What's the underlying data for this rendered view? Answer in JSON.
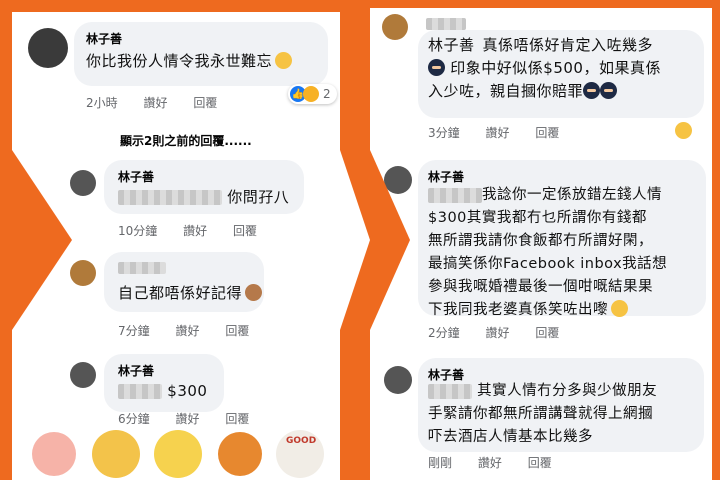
{
  "left_panel": {
    "comment1": {
      "author": "林子善",
      "text_line1": "你比我份人情令我永世難忘",
      "time": "2小時",
      "like": "讚好",
      "reply": "回覆",
      "reaction_count": "2"
    },
    "more_replies": "顯示2則之前的回覆......",
    "reply1": {
      "author": "林子善",
      "text": "你問孖八",
      "time": "10分鐘",
      "like": "讚好",
      "reply": "回覆"
    },
    "reply2": {
      "text": "自己都唔係好記得",
      "time": "7分鐘",
      "like": "讚好",
      "reply": "回覆"
    },
    "reply3": {
      "author": "林子善",
      "text": "$300",
      "time": "6分鐘",
      "like": "讚好",
      "reply": "回覆"
    },
    "sticker_labels": [
      "GOOD"
    ]
  },
  "right_panel": {
    "comment1": {
      "author": "林子善",
      "text_line1": "真係唔係好肯定入咗幾多",
      "text_line2": "印象中好似係$500，如果真係",
      "text_line3": "入少咗，親自摑你賠罪",
      "time": "3分鐘",
      "like": "讚好",
      "reply": "回覆"
    },
    "comment2": {
      "author": "林子善",
      "line1": "我諗你一定係放錯左錢人情",
      "line2": "$300其實我都冇乜所謂你有錢都",
      "line3": "無所謂我請你食飯都冇所謂好閑，",
      "line4": "最搞笑係你Facebook inbox我話想",
      "line5": "參與我嘅婚禮最後一個咁嘅結果果",
      "line6": "下我同我老婆真係笑咗出嚟",
      "time": "2分鐘",
      "like": "讚好",
      "reply": "回覆"
    },
    "comment3": {
      "author": "林子善",
      "line1": "其實人情冇分多與少做朋友",
      "line2": "手緊請你都無所謂講聲就得上網摑",
      "line3": "吓去酒店人情基本比幾多",
      "time": "剛剛",
      "like": "讚好",
      "reply": "回覆"
    }
  },
  "colors": {
    "background": "#ee6a1f",
    "bubble": "#f0f2f5",
    "meta_text": "#65676b",
    "like_blue": "#1877f2"
  }
}
